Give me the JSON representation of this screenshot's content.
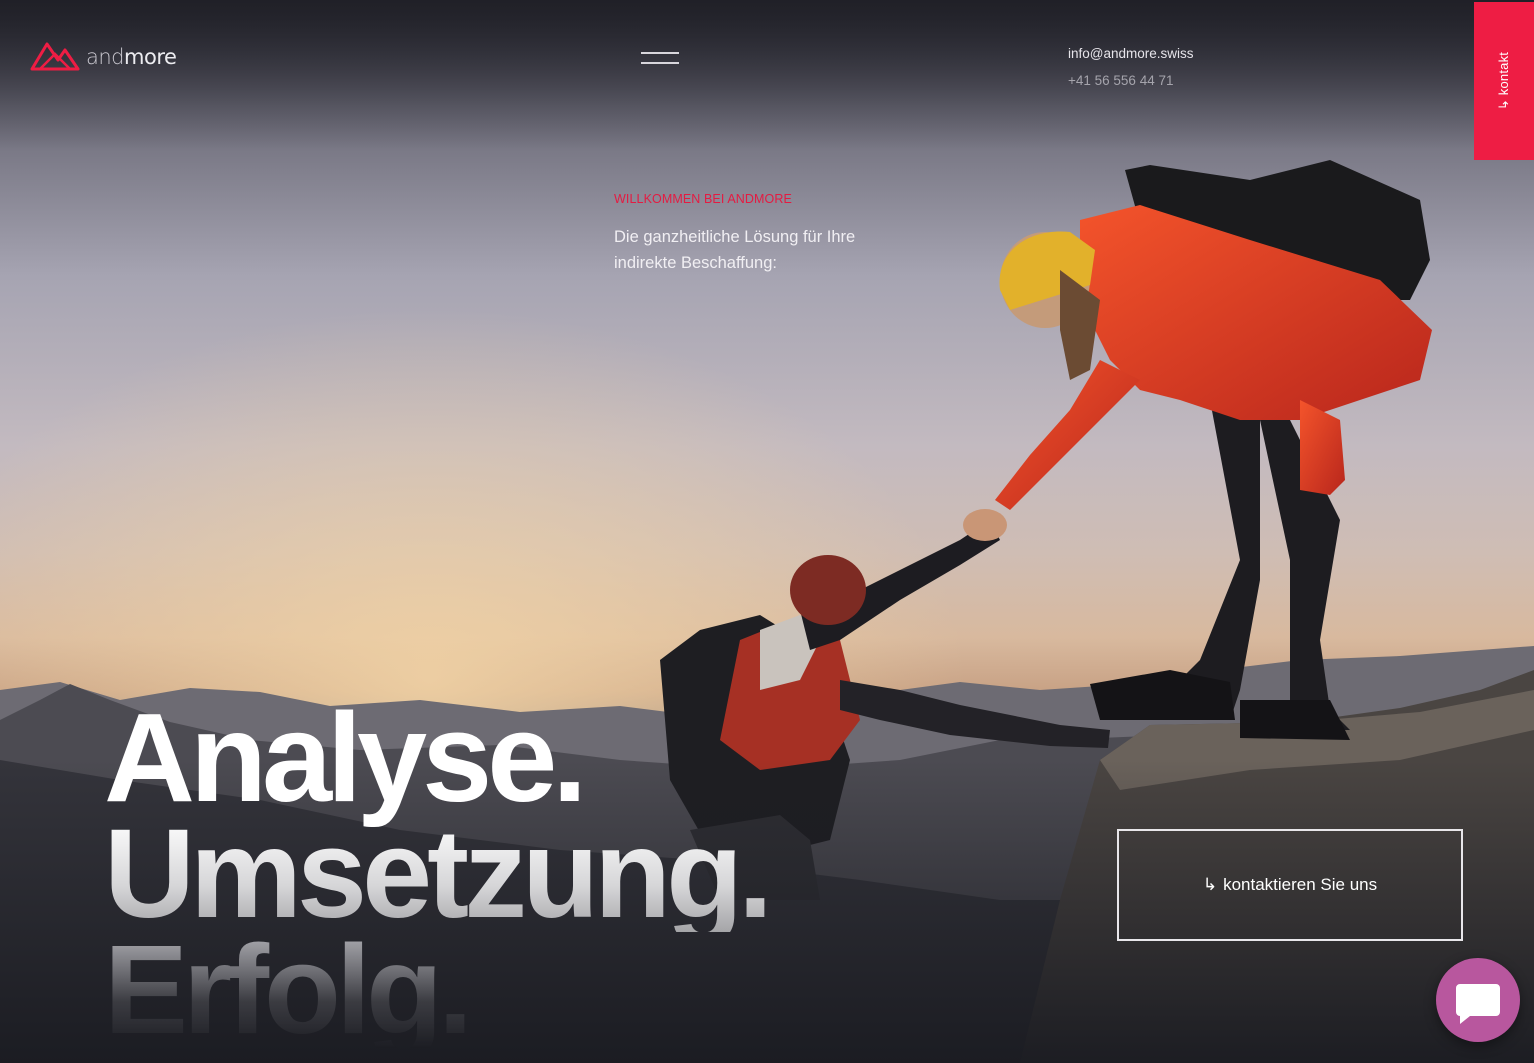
{
  "brand": {
    "name_light": "and",
    "name_bold": "more",
    "logo_icon": "mountain-icon",
    "accent_color": "#ee1d44"
  },
  "header": {
    "menu_icon": "hamburger-menu-icon",
    "email": "info@andmore.swiss",
    "phone": "+41 56 556 44 71"
  },
  "side_tab": {
    "label": "↳ kontakt"
  },
  "intro": {
    "eyebrow": "WILLKOMMEN BEI ANDMORE",
    "lead": "Die ganzheitliche Lösung für Ihre indirekte Beschaffung:"
  },
  "headline": {
    "line1": "Analyse.",
    "line2": "Umsetzung.",
    "line3": "Erfolg."
  },
  "cta": {
    "arrow": "↳",
    "label": "kontaktieren Sie uns"
  },
  "chat": {
    "icon": "chat-bubble-icon",
    "color": "#b8579e"
  }
}
